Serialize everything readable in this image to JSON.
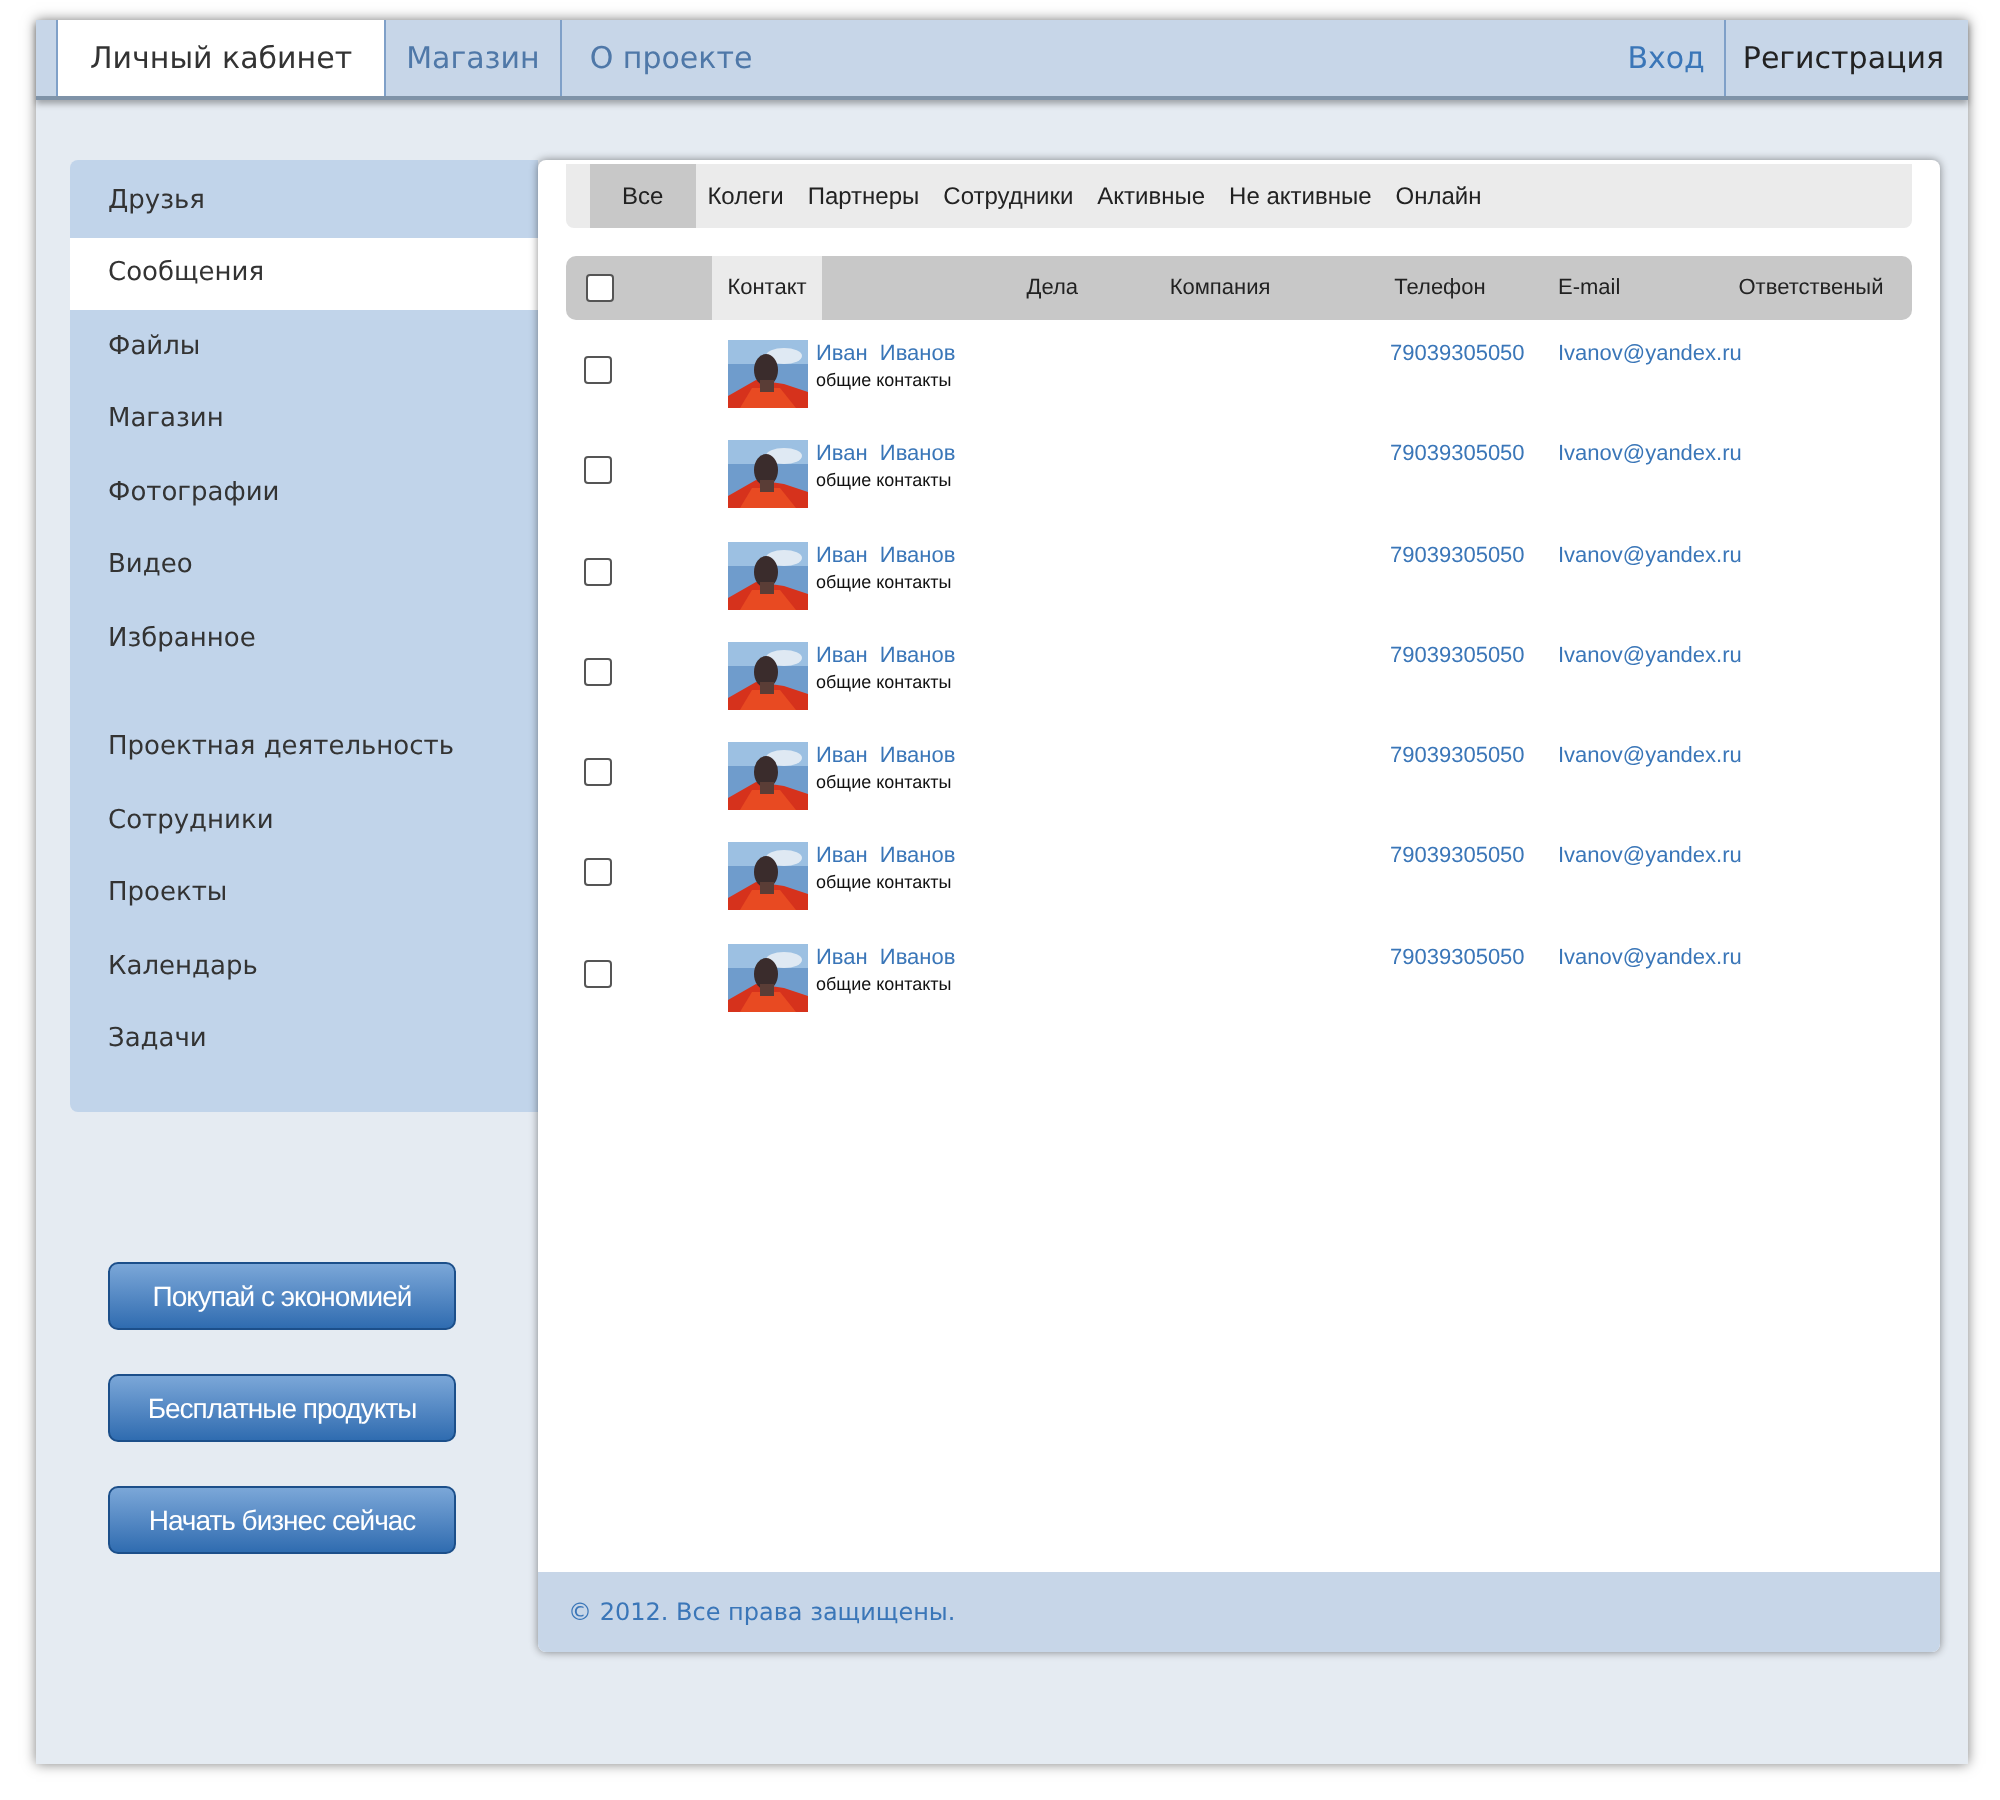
{
  "top_nav": {
    "items": [
      {
        "label": "Личный кабинет",
        "selected": true
      },
      {
        "label": "Магазин",
        "selected": false
      },
      {
        "label": "О проекте",
        "selected": false
      }
    ],
    "login": "Вход",
    "register": "Регистрация"
  },
  "sidebar": {
    "groups": [
      [
        {
          "label": "Друзья",
          "selected": false
        },
        {
          "label": "Сообщения",
          "selected": true
        },
        {
          "label": "Файлы",
          "selected": false
        },
        {
          "label": "Магазин",
          "selected": false
        },
        {
          "label": "Фотографии",
          "selected": false
        },
        {
          "label": "Видео",
          "selected": false
        },
        {
          "label": "Избранное",
          "selected": false
        }
      ],
      [
        {
          "label": "Проектная деятельность",
          "selected": false
        },
        {
          "label": "Сотрудники",
          "selected": false
        },
        {
          "label": "Проекты",
          "selected": false
        },
        {
          "label": "Календарь",
          "selected": false
        },
        {
          "label": "Задачи",
          "selected": false
        }
      ]
    ]
  },
  "promo_buttons": [
    "Покупай с экономией",
    "Бесплатные продукты",
    "Начать бизнес сейчас"
  ],
  "filter_tabs": [
    {
      "label": "Все",
      "selected": true
    },
    {
      "label": "Колеги",
      "selected": false
    },
    {
      "label": "Партнеры",
      "selected": false
    },
    {
      "label": "Сотрудники",
      "selected": false
    },
    {
      "label": "Активные",
      "selected": false
    },
    {
      "label": "Не активные",
      "selected": false
    },
    {
      "label": "Онлайн",
      "selected": false
    }
  ],
  "table": {
    "select_all": {
      "checked": false
    },
    "columns": [
      {
        "label": "Контакт",
        "selected": true
      },
      {
        "label": "Дела",
        "selected": false
      },
      {
        "label": "Компания",
        "selected": false
      },
      {
        "label": "Телефон",
        "selected": false
      },
      {
        "label": "E-mail",
        "selected": false
      },
      {
        "label": "Ответственый",
        "selected": false
      }
    ],
    "rows": [
      {
        "checked": false,
        "name": "Иван  Иванов",
        "group": "общие контакты",
        "phone": "79039305050",
        "email": "Ivanov@yandex.ru"
      },
      {
        "checked": false,
        "name": "Иван  Иванов",
        "group": "общие контакты",
        "phone": "79039305050",
        "email": "Ivanov@yandex.ru"
      },
      {
        "checked": false,
        "name": "Иван  Иванов",
        "group": "общие контакты",
        "phone": "79039305050",
        "email": "Ivanov@yandex.ru"
      },
      {
        "checked": false,
        "name": "Иван  Иванов",
        "group": "общие контакты",
        "phone": "79039305050",
        "email": "Ivanov@yandex.ru"
      },
      {
        "checked": false,
        "name": "Иван  Иванов",
        "group": "общие контакты",
        "phone": "79039305050",
        "email": "Ivanov@yandex.ru"
      },
      {
        "checked": false,
        "name": "Иван  Иванов",
        "group": "общие контакты",
        "phone": "79039305050",
        "email": "Ivanov@yandex.ru"
      },
      {
        "checked": false,
        "name": "Иван  Иванов",
        "group": "общие контакты",
        "phone": "79039305050",
        "email": "Ivanov@yandex.ru"
      }
    ]
  },
  "footer": "© 2012. Все права защищены."
}
